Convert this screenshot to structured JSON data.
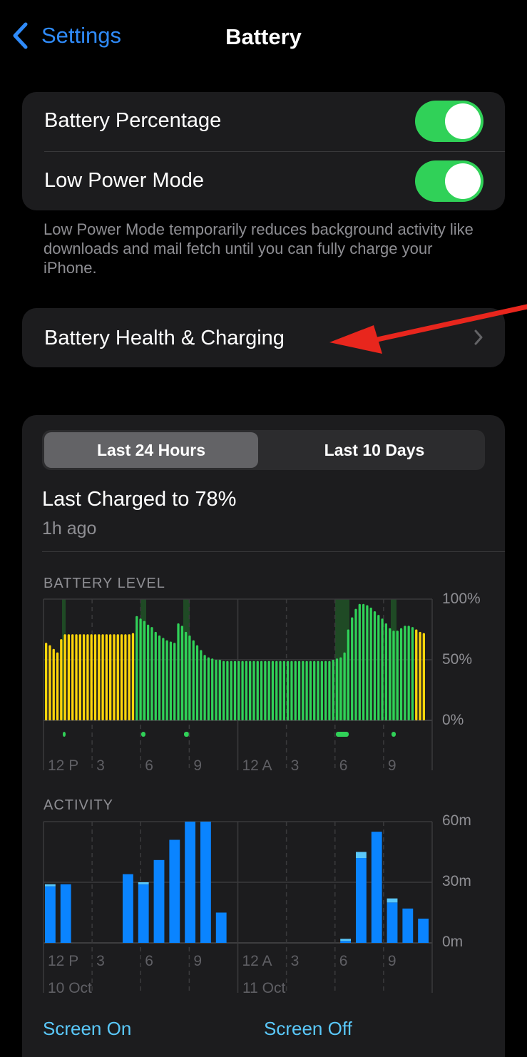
{
  "nav": {
    "back_label": "Settings",
    "title": "Battery"
  },
  "settings": {
    "battery_percentage": {
      "label": "Battery Percentage",
      "on": true
    },
    "low_power_mode": {
      "label": "Low Power Mode",
      "on": true
    },
    "footnote": "Low Power Mode temporarily reduces background activity like downloads and mail fetch until you can fully charge your iPhone."
  },
  "health": {
    "label": "Battery Health & Charging"
  },
  "usage": {
    "segments": [
      "Last 24 Hours",
      "Last 10 Days"
    ],
    "selected_segment": "Last 24 Hours",
    "last_charged": "Last Charged to 78%",
    "last_charged_ago": "1h ago",
    "battery_section_label": "BATTERY LEVEL",
    "activity_section_label": "ACTIVITY",
    "x_ticks": [
      "12 P",
      "3",
      "6",
      "9",
      "12 A",
      "3",
      "6",
      "9"
    ],
    "dates": [
      "10 Oct",
      "11 Oct"
    ],
    "legend": [
      "Screen On",
      "Screen Off"
    ]
  },
  "chart_data": [
    {
      "type": "bar",
      "title": "BATTERY LEVEL",
      "ylim": [
        0,
        100
      ],
      "y_ticks": [
        "100%",
        "50%",
        "0%"
      ],
      "x_ticks": [
        "12 P",
        "3",
        "6",
        "9",
        "12 A",
        "3",
        "6",
        "9"
      ],
      "values": [
        64,
        62,
        59,
        56,
        67,
        71,
        71,
        71,
        71,
        71,
        71,
        71,
        71,
        71,
        71,
        71,
        71,
        71,
        71,
        71,
        71,
        71,
        71,
        72,
        86,
        84,
        82,
        79,
        77,
        73,
        70,
        68,
        66,
        65,
        64,
        80,
        78,
        73,
        70,
        66,
        62,
        58,
        54,
        52,
        51,
        50,
        50,
        49,
        49,
        49,
        49,
        49,
        49,
        49,
        49,
        49,
        49,
        49,
        49,
        49,
        49,
        49,
        49,
        49,
        49,
        49,
        49,
        49,
        49,
        49,
        49,
        49,
        49,
        49,
        49,
        49,
        50,
        51,
        52,
        56,
        75,
        85,
        92,
        96,
        96,
        95,
        93,
        90,
        87,
        84,
        80,
        76,
        74,
        74,
        76,
        78,
        78,
        77,
        75,
        73,
        72
      ],
      "colors": {
        "charging_and_high": "#30d158",
        "low_power": "#ffd60a",
        "charging_band": "#1f4a25",
        "charging_marker": "#30d158"
      }
    },
    {
      "type": "bar",
      "title": "ACTIVITY",
      "ylim": [
        0,
        60
      ],
      "y_ticks": [
        "60m",
        "30m",
        "0m"
      ],
      "x_ticks": [
        "12 P",
        "3",
        "6",
        "9",
        "12 A",
        "3",
        "6",
        "9"
      ],
      "series": [
        {
          "name": "Screen On",
          "values": [
            28,
            29,
            0,
            0,
            0,
            34,
            29,
            41,
            51,
            60,
            60,
            15,
            0,
            0,
            0,
            0,
            0,
            0,
            0,
            1,
            42,
            55,
            20,
            17,
            12
          ]
        },
        {
          "name": "Screen Off",
          "values": [
            1,
            0,
            0,
            0,
            0,
            0,
            1,
            0,
            0,
            0,
            0,
            0,
            0,
            0,
            0,
            0,
            0,
            0,
            0,
            1,
            3,
            0,
            2,
            0,
            0
          ]
        }
      ],
      "colors": {
        "screen_on": "#0a84ff",
        "screen_off": "#5ac8fa"
      }
    }
  ]
}
